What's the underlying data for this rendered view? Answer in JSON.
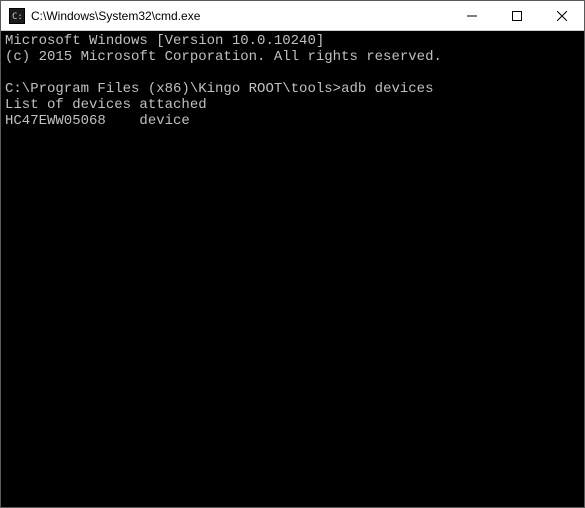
{
  "window": {
    "title": "C:\\Windows\\System32\\cmd.exe"
  },
  "terminal": {
    "banner_line1": "Microsoft Windows [Version 10.0.10240]",
    "banner_line2": "(c) 2015 Microsoft Corporation. All rights reserved.",
    "blank1": "",
    "prompt": "C:\\Program Files (x86)\\Kingo ROOT\\tools>",
    "command": "adb devices",
    "output_header": "List of devices attached",
    "output_row": "HC47EWW05068    device"
  }
}
